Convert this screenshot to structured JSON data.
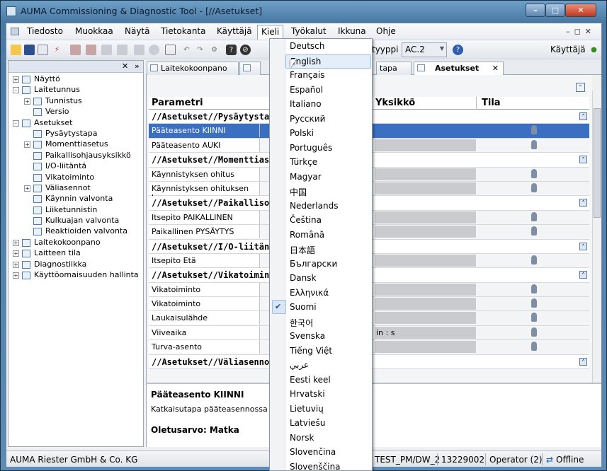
{
  "window": {
    "title": "AUMA Commissioning & Diagnostic Tool - [//Asetukset]"
  },
  "menubar": {
    "items": [
      "Tiedosto",
      "Muokkaa",
      "Näytä",
      "Tietokanta",
      "Käyttäjä",
      "Kieli",
      "Työkalut",
      "Ikkuna",
      "Ohje"
    ],
    "active": "Kieli"
  },
  "toolbar": {
    "tyyppi_label": "tyyppi",
    "tyyppi_value": "AC.2",
    "user_label": "Käyttäjä"
  },
  "tree": {
    "items": [
      {
        "label": "Näyttö",
        "level": 0,
        "expander": "+"
      },
      {
        "label": "Laitetunnus",
        "level": 0,
        "expander": "-"
      },
      {
        "label": "Tunnistus",
        "level": 1,
        "expander": "+"
      },
      {
        "label": "Versio",
        "level": 1,
        "expander": ""
      },
      {
        "label": "Asetukset",
        "level": 0,
        "expander": "-"
      },
      {
        "label": "Pysäytystapa",
        "level": 1,
        "expander": ""
      },
      {
        "label": "Momenttiasetus",
        "level": 1,
        "expander": "+"
      },
      {
        "label": "Paikallisohjausyksikkö",
        "level": 1,
        "expander": ""
      },
      {
        "label": "I/O-liitäntä",
        "level": 1,
        "expander": ""
      },
      {
        "label": "Vikatoiminto",
        "level": 1,
        "expander": ""
      },
      {
        "label": "Väliasennot",
        "level": 1,
        "expander": "+"
      },
      {
        "label": "Käynnin valvonta",
        "level": 1,
        "expander": ""
      },
      {
        "label": "Liiketunnistin",
        "level": 1,
        "expander": ""
      },
      {
        "label": "Kulkuajan valvonta",
        "level": 1,
        "expander": ""
      },
      {
        "label": "Reaktioiden valvonta",
        "level": 1,
        "expander": ""
      },
      {
        "label": "Laitekokoonpano",
        "level": 0,
        "expander": "+"
      },
      {
        "label": "Laitteen tila",
        "level": 0,
        "expander": "+"
      },
      {
        "label": "Diagnostiikka",
        "level": 0,
        "expander": "+"
      },
      {
        "label": "Käyttöomaisuuden hallinta",
        "level": 0,
        "expander": "+"
      }
    ]
  },
  "tabs": [
    {
      "label": "Laitekokoonpano"
    },
    {
      "label": "tapa"
    },
    {
      "label": "Asetukset"
    }
  ],
  "grid": {
    "headers": [
      "Parametri",
      "Yksikkö",
      "Tila"
    ],
    "rows": [
      {
        "type": "group",
        "label": "//Asetukset//Pysäytystapa"
      },
      {
        "type": "item",
        "label": "Pääteasento KIINNI",
        "value": "",
        "selected": true
      },
      {
        "type": "item",
        "label": "Pääteasento AUKI",
        "value": ""
      },
      {
        "type": "group",
        "label": "//Asetukset//Momenttiasetus"
      },
      {
        "type": "item",
        "label": "Käynnistyksen ohitus",
        "value": ""
      },
      {
        "type": "item",
        "label": "Käynnistyksen ohituksen k...",
        "value": ""
      },
      {
        "type": "group",
        "label": "//Asetukset//Paikallisohjausyksikkö"
      },
      {
        "type": "item",
        "label": "Itsepito PAIKALLINEN",
        "value": ""
      },
      {
        "type": "item",
        "label": "Paikallinen PYSÄYTYS",
        "value": ""
      },
      {
        "type": "group",
        "label": "//Asetukset//I/O-liitäntä"
      },
      {
        "type": "item",
        "label": "Itsepito Etä",
        "value": ""
      },
      {
        "type": "group",
        "label": "//Asetukset//Vikatoiminto"
      },
      {
        "type": "item",
        "label": "Vikatoiminto",
        "value": ""
      },
      {
        "type": "item",
        "label": "Vikatoiminto",
        "value": ""
      },
      {
        "type": "item",
        "label": "Laukaisulähde",
        "value": ""
      },
      {
        "type": "item",
        "label": "Viiveaika",
        "value": "in : s"
      },
      {
        "type": "item",
        "label": "Turva-asento",
        "value": ""
      },
      {
        "type": "group",
        "label": "//Asetukset//Väliasennot"
      }
    ]
  },
  "detail": {
    "title": "Pääteasento KIINNI",
    "description": "Katkaisutapa pääteasennossa",
    "default_label": "Oletusarvo: Matka"
  },
  "statusbar": {
    "company": "AUMA Riester GmbH & Co. KG",
    "device": "TEST_PM/DW_2",
    "serial": "13229002",
    "user": "Operator (2)",
    "connection": "Offline"
  },
  "language_menu": {
    "items": [
      "Deutsch",
      "English",
      "Français",
      "Español",
      "Italiano",
      "Русский",
      "Polski",
      "Português",
      "Türkçe",
      "Magyar",
      "中国",
      "Nederlands",
      "Čeština",
      "Română",
      "日本語",
      "Български",
      "Dansk",
      "Ελληνικά",
      "Suomi",
      "한국어",
      "Svenska",
      "Tiếng Việt",
      "عربي",
      "Eesti keel",
      "Hrvatski",
      "Lietuvių",
      "Latviešu",
      "Norsk",
      "Slovenčina",
      "Slovenščina"
    ],
    "hovered": "English",
    "checked": "Suomi"
  }
}
